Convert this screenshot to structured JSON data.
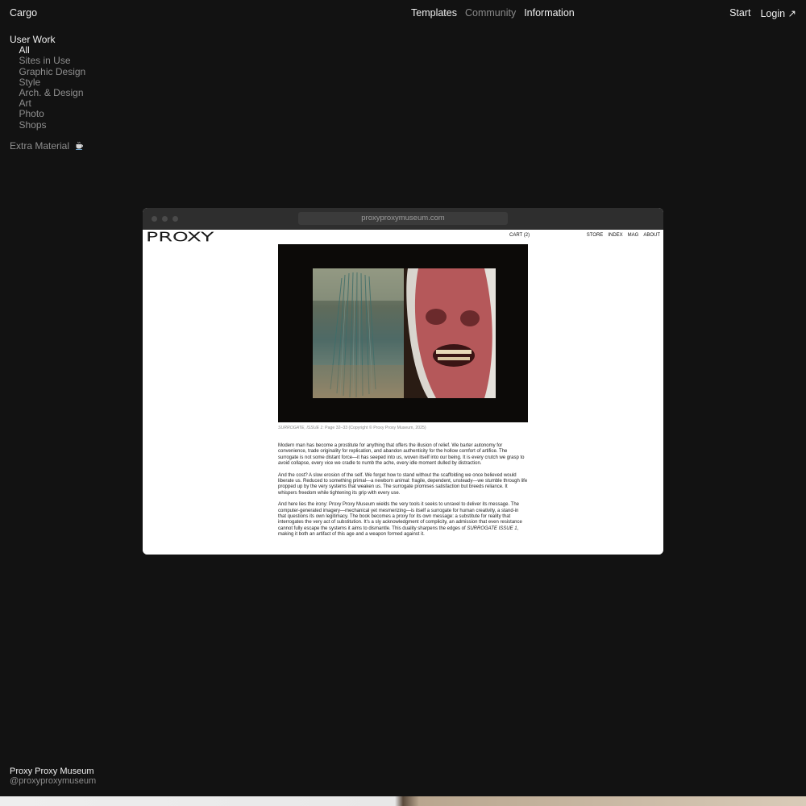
{
  "header": {
    "brand": "Cargo",
    "nav": [
      {
        "label": "Templates",
        "active": true
      },
      {
        "label": "Community",
        "active": false
      },
      {
        "label": "Information",
        "active": true
      }
    ],
    "start_label": "Start",
    "login_label": "Login ↗"
  },
  "sidebar": {
    "heading": "User Work",
    "items": [
      {
        "label": "All",
        "active": true
      },
      {
        "label": "Sites in Use",
        "active": false
      },
      {
        "label": "Graphic Design",
        "active": false
      },
      {
        "label": "Style",
        "active": false
      },
      {
        "label": "Arch. & Design",
        "active": false
      },
      {
        "label": "Art",
        "active": false
      },
      {
        "label": "Photo",
        "active": false
      },
      {
        "label": "Shops",
        "active": false
      }
    ],
    "extra_label": "Extra Material",
    "extra_icon": "coffee-cup-icon"
  },
  "browser": {
    "url": "proxyproxymuseum.com"
  },
  "site": {
    "logo": "PROXY",
    "cart": "CART (2)",
    "nav": [
      "STORE",
      "INDEX",
      "MAG",
      "ABOUT"
    ],
    "caption_italic": "SURROGATE, ISSUE 1",
    "caption_rest": ": Page 32–33 (Copyright © Proxy Proxy Museum, 2025)",
    "paragraphs": [
      "Modern man has become a prostitute for anything that offers the illusion of relief. We barter autonomy for convenience, trade originality for replication, and abandon authenticity for the hollow comfort of artifice. The surrogate is not some distant force—it has seeped into us, woven itself into our being. It is every crutch we grasp to avoid collapse, every vice we cradle to numb the ache, every idle moment dulled by distraction.",
      "And the cost? A slow erosion of the self. We forget how to stand without the scaffolding we once believed would liberate us. Reduced to something primal—a newborn animal: fragile, dependent, unsteady—we stumble through life propped up by the very systems that weaken us. The surrogate promises satisfaction but breeds reliance. It whispers freedom while tightening its grip with every use."
    ],
    "paragraph3_pre": "And here lies the irony: Proxy Proxy Museum wields the very tools it seeks to unravel to deliver its message. The computer-generated imagery—mechanical yet mesmerizing—is itself a surrogate for human creativity, a stand-in that questions its own legitimacy. The book becomes a proxy for its own message: a substitute for reality that interrogates the very act of substitution. It's a sly acknowledgment of complicity, an admission that even resistance cannot fully escape the systems it aims to dismantle. This duality sharpens the edges of ",
    "paragraph3_italic": "SURROGATE ISSUE 1",
    "paragraph3_post": ", making it both an artifact of this age and a weapon formed against it."
  },
  "footer": {
    "name": "Proxy Proxy Museum",
    "handle": "@proxyproxymuseum"
  }
}
